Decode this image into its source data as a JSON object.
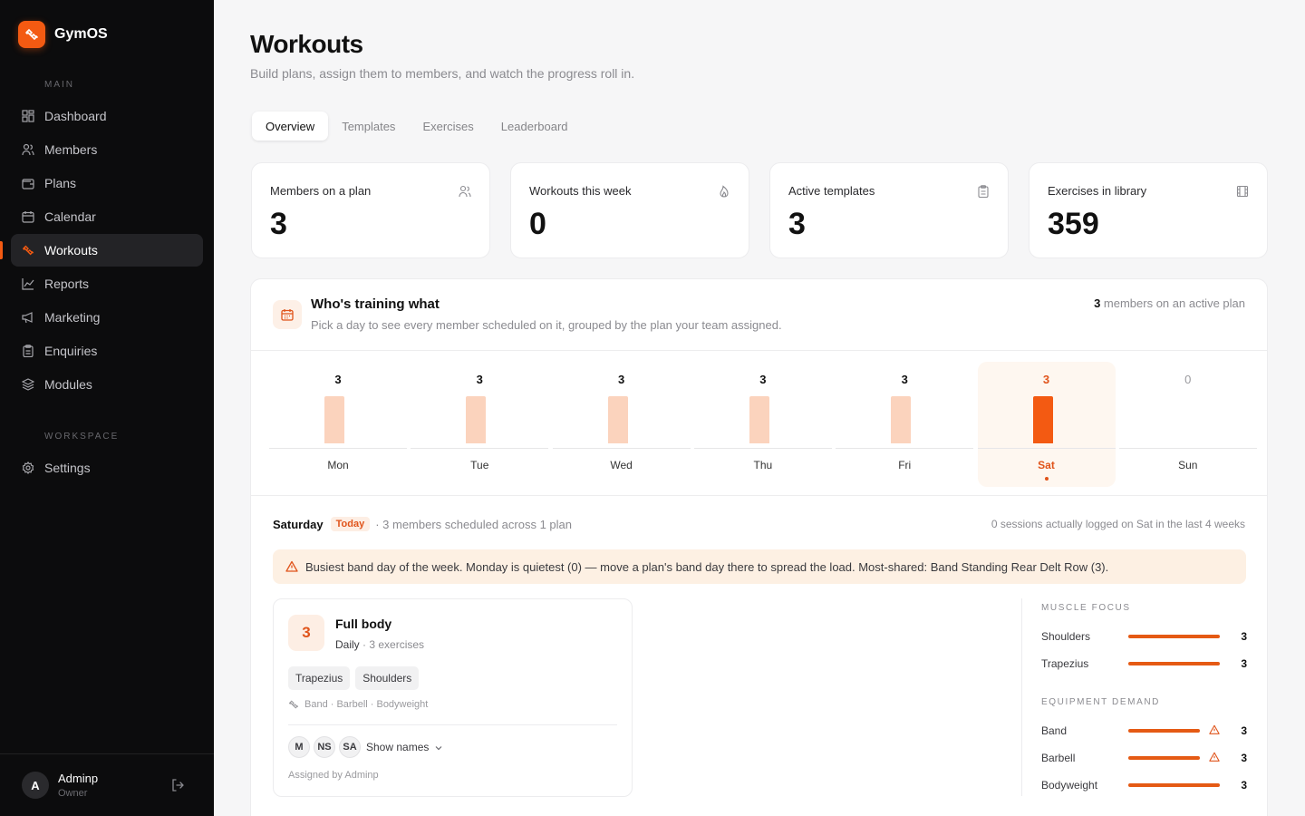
{
  "app": {
    "name": "GymOS",
    "accent": "#f35a12"
  },
  "sidebar": {
    "main_label": "MAIN",
    "items": [
      {
        "label": "Dashboard",
        "icon": "dashboard-icon"
      },
      {
        "label": "Members",
        "icon": "users-icon"
      },
      {
        "label": "Plans",
        "icon": "wallet-icon"
      },
      {
        "label": "Calendar",
        "icon": "calendar-icon"
      },
      {
        "label": "Workouts",
        "icon": "dumbbell-icon",
        "active": true
      },
      {
        "label": "Reports",
        "icon": "chart-line-icon"
      },
      {
        "label": "Marketing",
        "icon": "megaphone-icon"
      },
      {
        "label": "Enquiries",
        "icon": "clipboard-icon"
      },
      {
        "label": "Modules",
        "icon": "layers-icon"
      }
    ],
    "workspace_label": "WORKSPACE",
    "workspace_items": [
      {
        "label": "Settings",
        "icon": "gear-icon"
      }
    ],
    "user": {
      "initial": "A",
      "name": "Adminp",
      "role": "Owner"
    }
  },
  "header": {
    "title": "Workouts",
    "subtitle": "Build plans, assign them to members, and watch the progress roll in."
  },
  "tabs": [
    {
      "label": "Overview",
      "active": true
    },
    {
      "label": "Templates"
    },
    {
      "label": "Exercises"
    },
    {
      "label": "Leaderboard"
    }
  ],
  "stats": [
    {
      "label": "Members on a plan",
      "value": "3",
      "icon": "users-icon"
    },
    {
      "label": "Workouts this week",
      "value": "0",
      "icon": "flame-icon"
    },
    {
      "label": "Active templates",
      "value": "3",
      "icon": "clipboard-icon"
    },
    {
      "label": "Exercises in library",
      "value": "359",
      "icon": "film-icon"
    }
  ],
  "training": {
    "title": "Who's training what",
    "subtitle": "Pick a day to see every member scheduled on it, grouped by the plan your team assigned.",
    "active_count": "3",
    "active_text": " members on an active plan",
    "days": [
      {
        "label": "Mon",
        "count": 3
      },
      {
        "label": "Tue",
        "count": 3
      },
      {
        "label": "Wed",
        "count": 3
      },
      {
        "label": "Thu",
        "count": 3
      },
      {
        "label": "Fri",
        "count": 3
      },
      {
        "label": "Sat",
        "count": 3,
        "selected": true
      },
      {
        "label": "Sun",
        "count": 0
      }
    ],
    "selected_day": "Saturday",
    "today_badge": "Today",
    "selected_summary": "· 3 members scheduled across 1 plan",
    "sessions_note": "0 sessions actually logged on Sat in the last 4 weeks",
    "alert": "Busiest band day of the week. Monday is quietest (0) — move a plan's band day there to spread the load. Most-shared: Band Standing Rear Delt Row (3)."
  },
  "plan": {
    "count": "3",
    "name": "Full body",
    "frequency": "Daily",
    "exercises": "· 3 exercises",
    "muscles": [
      "Trapezius",
      "Shoulders"
    ],
    "equipment": "Band · Barbell · Bodyweight",
    "members": [
      "M",
      "NS",
      "SA"
    ],
    "show_names": "Show names",
    "assigned_by": "Assigned by Adminp"
  },
  "muscle_focus": {
    "title": "MUSCLE FOCUS",
    "items": [
      {
        "label": "Shoulders",
        "value": "3",
        "fraction": 1.0
      },
      {
        "label": "Trapezius",
        "value": "3",
        "fraction": 1.0
      }
    ]
  },
  "equipment_demand": {
    "title": "EQUIPMENT DEMAND",
    "items": [
      {
        "label": "Band",
        "value": "3",
        "fraction": 1.0,
        "warning": true
      },
      {
        "label": "Barbell",
        "value": "3",
        "fraction": 1.0,
        "warning": true
      },
      {
        "label": "Bodyweight",
        "value": "3",
        "fraction": 1.0,
        "warning": false
      }
    ]
  }
}
